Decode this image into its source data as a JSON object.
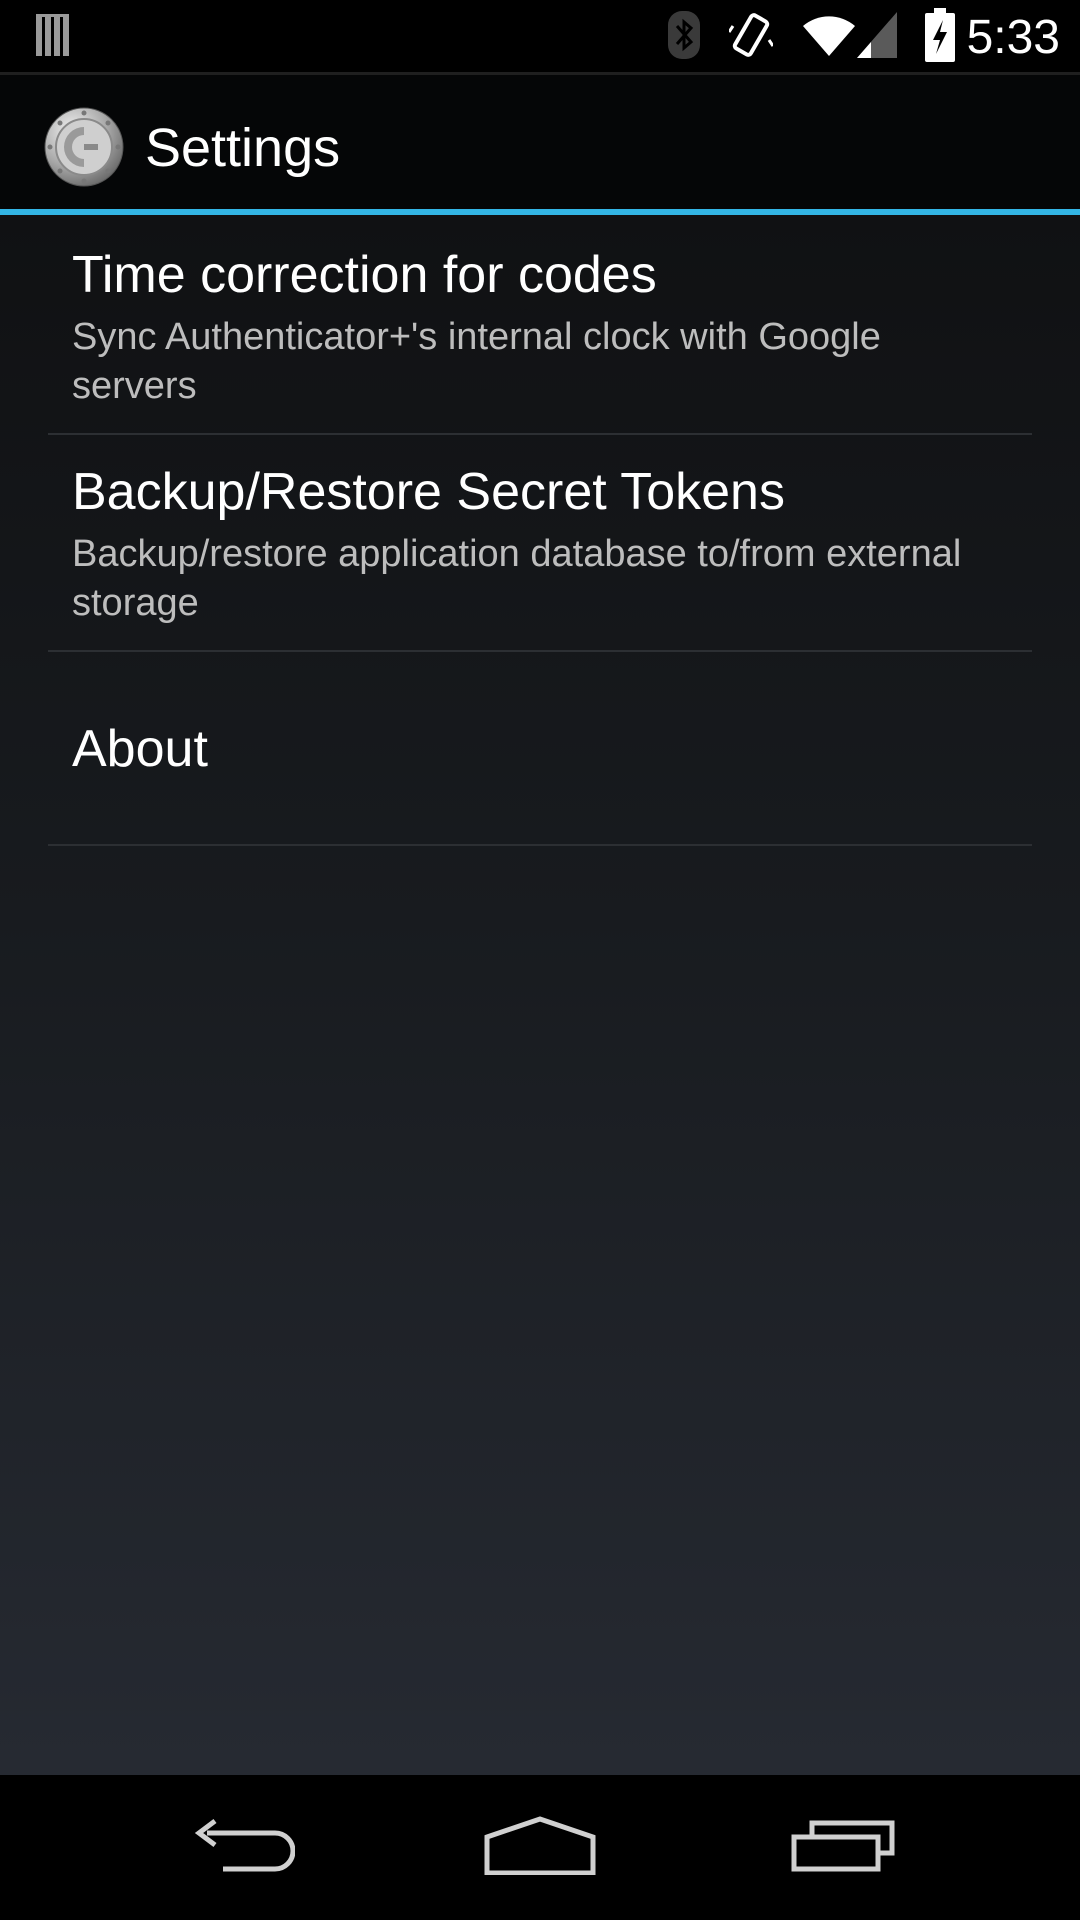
{
  "status_bar": {
    "time": "5:33",
    "icons": [
      "notification-icon",
      "bluetooth-icon",
      "vibrate-icon",
      "wifi-icon",
      "cell-signal-icon",
      "battery-charging-icon"
    ]
  },
  "action_bar": {
    "title": "Settings",
    "logo_icon": "authenticator-logo-icon",
    "accent_color": "#33b5e5"
  },
  "preferences": [
    {
      "title": "Time correction for codes",
      "summary": "Sync Authenticator+'s internal clock with Google servers"
    },
    {
      "title": "Backup/Restore Secret Tokens",
      "summary": "Backup/restore application database to/from external storage"
    },
    {
      "title": "About",
      "summary": ""
    }
  ],
  "nav_bar": {
    "buttons": [
      "back-icon",
      "home-icon",
      "recent-apps-icon"
    ]
  }
}
